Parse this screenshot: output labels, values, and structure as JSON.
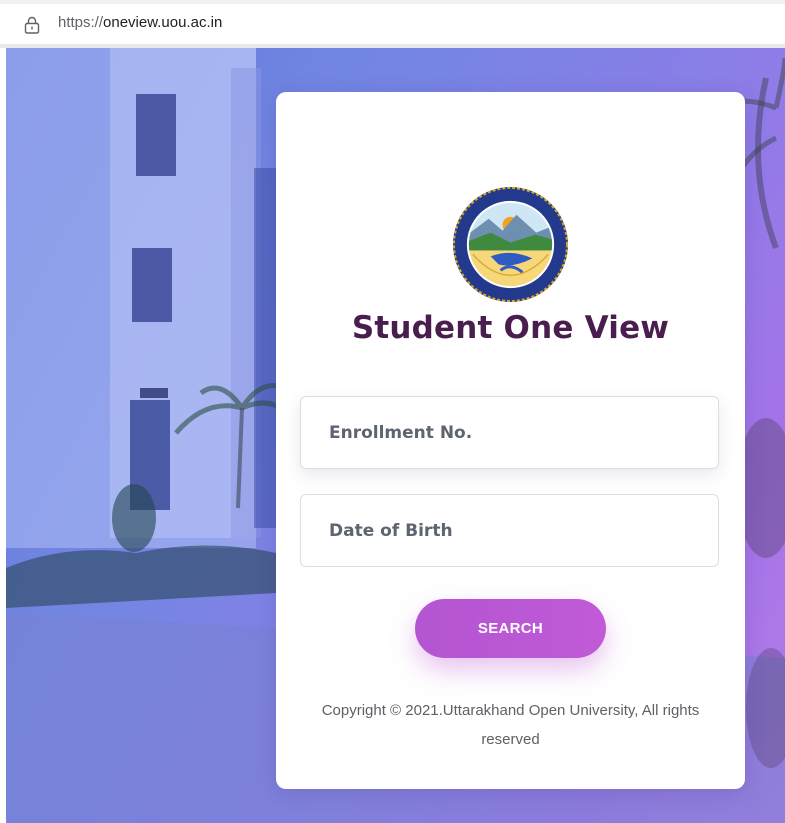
{
  "browser": {
    "url_scheme": "https://",
    "url_host": "oneview.uou.ac.in"
  },
  "card": {
    "title": "Student One View",
    "logo_icon": "university-emblem-icon",
    "enrollment": {
      "placeholder": "Enrollment No.",
      "value": ""
    },
    "dob": {
      "placeholder": "Date of Birth",
      "value": ""
    },
    "search_label": "SEARCH",
    "copyright": "Copyright © 2021.Uttarakhand Open University, All rights reserved"
  },
  "colors": {
    "title": "#4a1d4f",
    "button": "#bb57d5",
    "overlay_start": "#5a6fd8",
    "overlay_end": "#b877e6"
  }
}
